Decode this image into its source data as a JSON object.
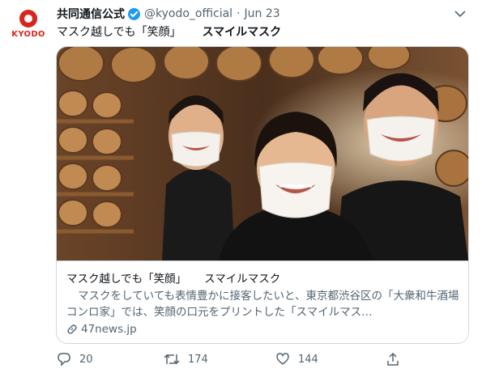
{
  "account": {
    "display_name": "共同通信公式",
    "handle": "@kyodo_official",
    "separator": "·",
    "date": "Jun 23",
    "avatar_logo_text": "KYODO"
  },
  "tweet": {
    "text": "マスク越しでも「笑顔」",
    "text_bold": "スマイルマスク"
  },
  "card": {
    "title": "マスク越しでも「笑顔」",
    "title_suffix": "スマイルマスク",
    "description": "マスクをしていても表情豊かに接客したいと、東京都渋谷区の「大衆和牛酒場コンロ家」では、笑顔の口元をプリントした「スマイルマス…",
    "domain": "47news.jp",
    "image_alt": "three staff members wearing smile-printed masks in a restaurant"
  },
  "actions": {
    "reply_count": "20",
    "retweet_count": "174",
    "like_count": "144"
  },
  "colors": {
    "brand_red": "#d7261b",
    "verified_blue": "#1d9bf0",
    "muted_text": "#536471",
    "border": "#cfd9de"
  },
  "icons": [
    "kyodo-logo-icon",
    "verified-badge-icon",
    "chevron-down-icon",
    "link-icon",
    "reply-icon",
    "retweet-icon",
    "like-icon",
    "share-icon"
  ]
}
